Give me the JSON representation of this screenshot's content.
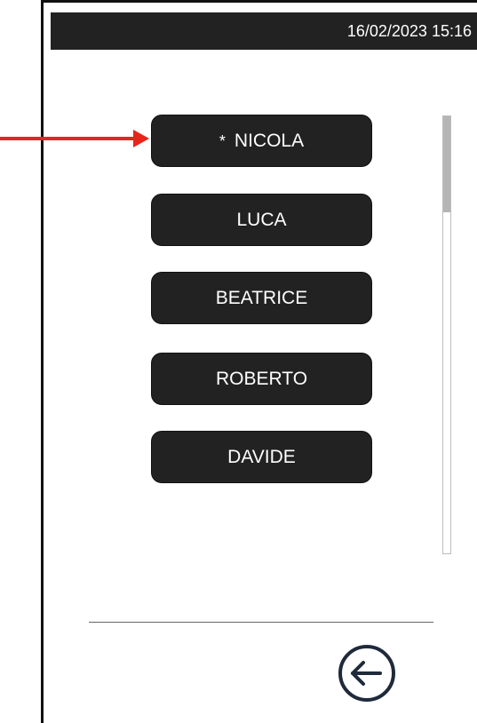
{
  "status_bar": {
    "datetime": "16/02/2023 15:16"
  },
  "user_list": {
    "items": [
      {
        "label": "NICOLA",
        "favorite": true,
        "favorite_glyph": "*"
      },
      {
        "label": "LUCA",
        "favorite": false
      },
      {
        "label": "BEATRICE",
        "favorite": false
      },
      {
        "label": "ROBERTO",
        "favorite": false
      },
      {
        "label": "DAVIDE",
        "favorite": false
      }
    ]
  },
  "icons": {
    "annotation_arrow": "red-arrow-icon",
    "back": "arrow-left-circle-icon"
  },
  "colors": {
    "button_bg": "#222222",
    "button_text": "#ffffff",
    "status_bar_bg": "#222222",
    "annotation_arrow": "#e8241b",
    "back_icon": "#1f2a3a"
  }
}
